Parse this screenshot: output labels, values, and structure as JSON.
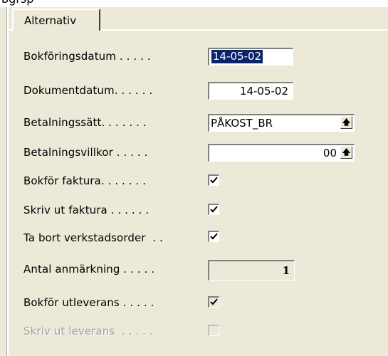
{
  "header_fragment": "bgrsp",
  "tabs": [
    {
      "label": "Alternativ"
    }
  ],
  "fields": {
    "bokforingsdatum": {
      "label": "Bokföringsdatum . . . . .",
      "value": "14-05-02"
    },
    "dokumentdatum": {
      "label": "Dokumentdatum. . . . . .",
      "value": "14-05-02"
    },
    "betalningssatt": {
      "label": "Betalningssätt. . . . . . .",
      "value": "PÅKOST_BR",
      "button_icon": "arrow-up-icon"
    },
    "betalningsvillkor": {
      "label": "Betalningsvillkor . . . . .",
      "value": "00",
      "button_icon": "arrow-up-icon"
    },
    "bokfor_faktura": {
      "label": "Bokför faktura. . . . . . .",
      "checked": true
    },
    "skriv_ut_faktura": {
      "label": "Skriv ut faktura . . . . . .",
      "checked": true
    },
    "ta_bort_verkstadsorder": {
      "label": "Ta bort verkstadsorder  . .",
      "checked": true
    },
    "antal_anmarkning": {
      "label": "Antal anmärkning . . . . .",
      "value": "1"
    },
    "bokfor_utleverans": {
      "label": "Bokför utleverans . . . . .",
      "checked": true,
      "disabled": true
    },
    "skriv_ut_leverans": {
      "label": "Skriv ut leverans  . . . . .",
      "checked": false,
      "disabled": true
    }
  },
  "colors": {
    "background": "#ece9d8",
    "selection": "#0a246a",
    "disabled_text": "#a0a0a0"
  }
}
